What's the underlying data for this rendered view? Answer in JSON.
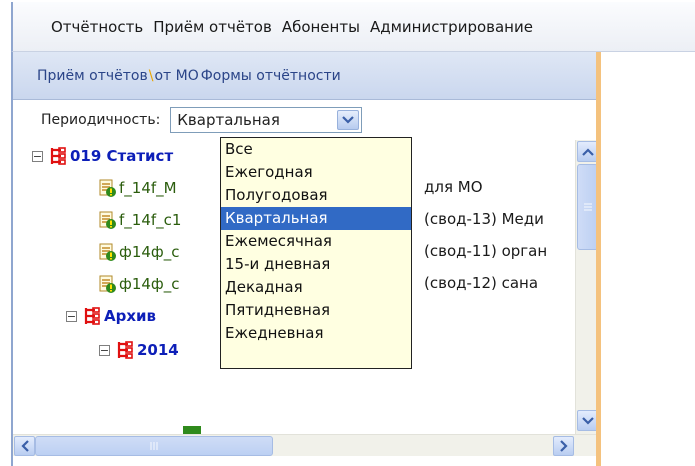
{
  "menu": [
    "Отчётность",
    "Приём отчётов",
    "Абоненты",
    "Администрирование"
  ],
  "breadcrumb": {
    "part1": "Приём отчётов",
    "separator": "\\",
    "part2": "от МО",
    "part3": "Формы отчётности"
  },
  "periodicity": {
    "label": "Периодичность:",
    "selected": "Квартальная",
    "options": [
      "Все",
      "Ежегодная",
      "Полугодовая",
      "Квартальная",
      "Ежемесячная",
      "15-и дневная",
      "Декадная",
      "Пятидневная",
      "Ежедневная"
    ],
    "selected_index": 3
  },
  "tree": {
    "root": {
      "label": "019 Статист",
      "expander": "−"
    },
    "forms": [
      {
        "label": "f_14f_M",
        "tail": "для МО"
      },
      {
        "label": "f_14f_c1",
        "tail": "(свод-13) Меди"
      },
      {
        "label": "ф14ф_с",
        "tail": "(свод-11) орган"
      },
      {
        "label": "ф14ф_с",
        "tail": "(свод-12) сана"
      }
    ],
    "archive": {
      "label": "Архив",
      "expander": "−"
    },
    "year": {
      "label": "2014",
      "expander": "−"
    }
  },
  "colors": {
    "folder_icon": "#e01010",
    "folder_label": "#0d1fb8",
    "selection": "#316ac5",
    "dropdown_bg": "#ffffe1",
    "panel_accent": "#f4c27e"
  },
  "icons": [
    "folder-tree-icon",
    "form-doc-icon",
    "chevron-down-icon",
    "arrow-up-icon",
    "arrow-down-icon",
    "arrow-left-icon",
    "arrow-right-icon"
  ]
}
